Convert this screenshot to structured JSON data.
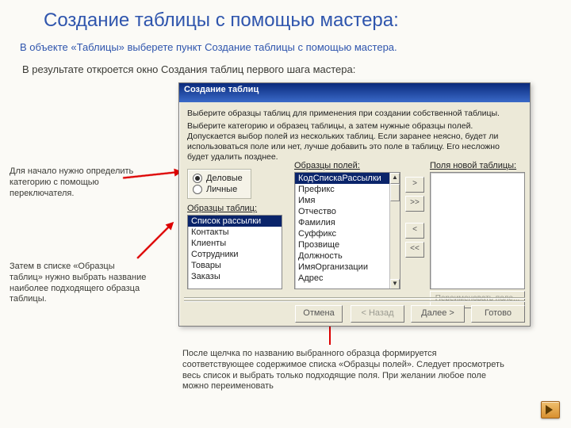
{
  "title": "Создание таблицы с помощью мастера:",
  "intro1": "В объекте «Таблицы» выберете пункт Создание таблицы с помощью мастера.",
  "intro2": "В результате откроется окно Создания таблиц первого шага мастера:",
  "annotations": {
    "left1": "Для начало нужно определить категорию с помощью переключателя.",
    "left2": "Затем в списке  «Образцы таблиц» нужно выбрать название наиболее подходящего образца таблицы.",
    "bottom": "После щелчка по названию выбранного образца формируется соответствующее содержимое списка «Образцы полей». Следует просмотреть весь список и выбрать только подходящие поля. При желании любое поле можно переименовать"
  },
  "dialog": {
    "title": "Создание таблиц",
    "instr1": "Выберите образцы таблиц для применения при создании собственной таблицы.",
    "instr2": "Выберите категорию и образец таблицы, а затем нужные образцы полей. Допускается выбор полей из нескольких таблиц. Если заранее неясно, будет ли использоваться поле или нет, лучше добавить это поле в таблицу. Его несложно будет удалить позднее.",
    "radios": {
      "opt1": "Деловые",
      "opt2": "Личные",
      "selected": "Деловые"
    },
    "labels": {
      "templates": "Образцы таблиц:",
      "fields": "Образцы полей:",
      "newfields": "Поля новой таблицы:"
    },
    "templates": [
      "Список рассылки",
      "Контакты",
      "Клиенты",
      "Сотрудники",
      "Товары",
      "Заказы"
    ],
    "templates_selected": "Список рассылки",
    "fields": [
      "КодСпискаРассылки",
      "Префикс",
      "Имя",
      "Отчество",
      "Фамилия",
      "Суффикс",
      "Прозвище",
      "Должность",
      "ИмяОрганизации",
      "Адрес"
    ],
    "fields_selected": "КодСпискаРассылки",
    "buttons": {
      "add": ">",
      "addall": ">>",
      "remove": "<",
      "removeall": "<<",
      "rename": "Переименовать поле...",
      "cancel": "Отмена",
      "back": "< Назад",
      "next": "Далее >",
      "finish": "Готово"
    }
  }
}
